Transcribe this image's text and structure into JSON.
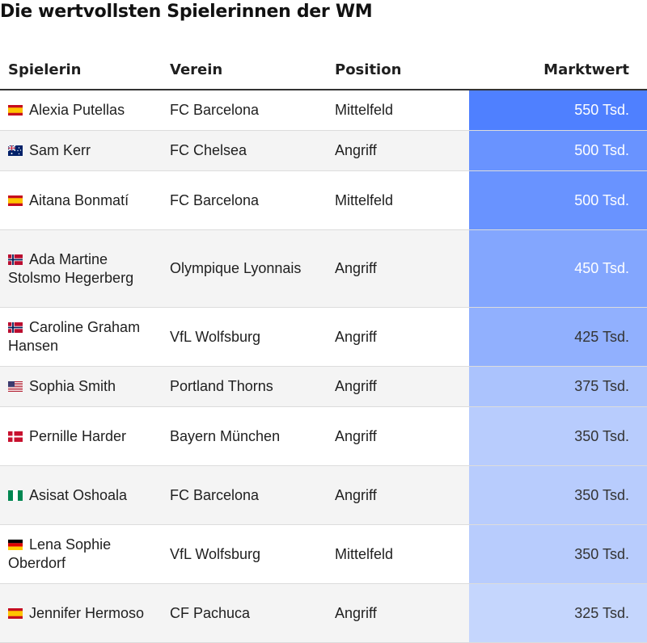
{
  "title": "Die wertvollsten Spielerinnen der WM",
  "columns": [
    "Spielerin",
    "Verein",
    "Position",
    "Marktwert"
  ],
  "colors": {
    "scale_high": "#4f80ff",
    "scale_low": "#c5d6fd",
    "text_light": "#ffffff",
    "text_dark": "#333333"
  },
  "chart_data": {
    "type": "table",
    "value_unit": "Tsd.",
    "rows": [
      {
        "player": "Alexia Putellas",
        "flag": "spain-flag-icon",
        "club": "FC Barcelona",
        "position": "Mittelfeld",
        "value": 550,
        "value_label": "550 Tsd."
      },
      {
        "player": "Sam Kerr",
        "flag": "australia-flag-icon",
        "club": "FC Chelsea",
        "position": "Angriff",
        "value": 500,
        "value_label": "500 Tsd."
      },
      {
        "player": "Aitana Bonmatí",
        "flag": "spain-flag-icon",
        "club": "FC Barcelona",
        "position": "Mittelfeld",
        "value": 500,
        "value_label": "500 Tsd."
      },
      {
        "player": "Ada Martine Stolsmo Hegerberg",
        "flag": "norway-flag-icon",
        "club": "Olympique Lyonnais",
        "position": "Angriff",
        "value": 450,
        "value_label": "450 Tsd."
      },
      {
        "player": "Caroline Graham Hansen",
        "flag": "norway-flag-icon",
        "club": "VfL Wolfsburg",
        "position": "Angriff",
        "value": 425,
        "value_label": "425 Tsd."
      },
      {
        "player": "Sophia Smith",
        "flag": "usa-flag-icon",
        "club": "Portland Thorns",
        "position": "Angriff",
        "value": 375,
        "value_label": "375 Tsd."
      },
      {
        "player": "Pernille Harder",
        "flag": "denmark-flag-icon",
        "club": "Bayern München",
        "position": "Angriff",
        "value": 350,
        "value_label": "350 Tsd."
      },
      {
        "player": "Asisat Oshoala",
        "flag": "nigeria-flag-icon",
        "club": "FC Barcelona",
        "position": "Angriff",
        "value": 350,
        "value_label": "350 Tsd."
      },
      {
        "player": "Lena Sophie Oberdorf",
        "flag": "germany-flag-icon",
        "club": "VfL Wolfsburg",
        "position": "Mittelfeld",
        "value": 350,
        "value_label": "350 Tsd."
      },
      {
        "player": "Jennifer Hermoso",
        "flag": "spain-flag-icon",
        "club": "CF Pachuca",
        "position": "Angriff",
        "value": 325,
        "value_label": "325 Tsd."
      }
    ]
  }
}
